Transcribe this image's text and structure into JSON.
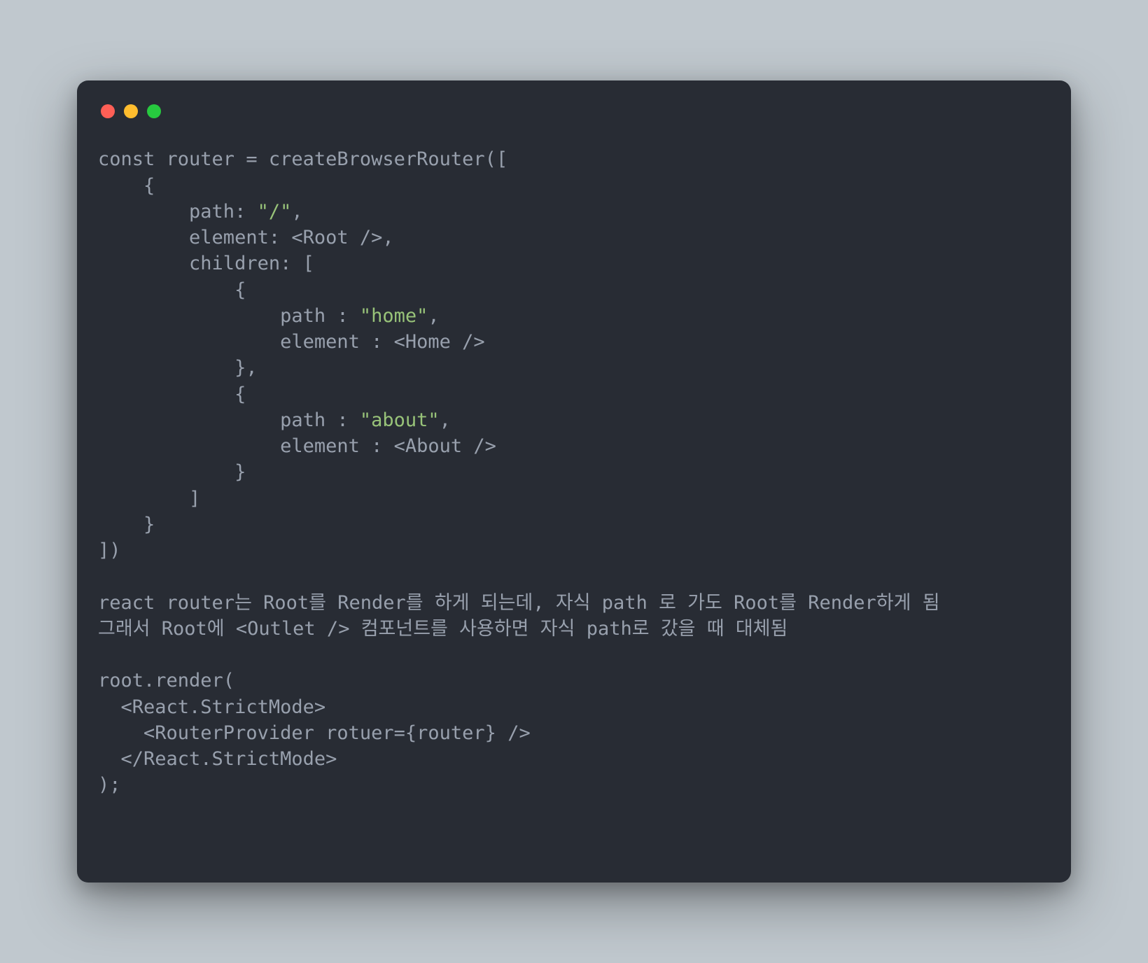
{
  "colors": {
    "background": "#c0c8ce",
    "window": "#282c34",
    "text": "#98a0ad",
    "string": "#98c379",
    "trafficRed": "#ff5f56",
    "trafficYellow": "#ffbd2e",
    "trafficGreen": "#27c93f"
  },
  "code": {
    "l1": "const router = createBrowserRouter([",
    "l2": "    {",
    "l3a": "        path: ",
    "l3s": "\"/\"",
    "l3b": ",",
    "l4": "        element: <Root />,",
    "l5": "        children: [",
    "l6": "            {",
    "l7a": "                path : ",
    "l7s": "\"home\"",
    "l7b": ",",
    "l8": "                element : <Home />",
    "l9": "            },",
    "l10": "            {",
    "l11a": "                path : ",
    "l11s": "\"about\"",
    "l11b": ",",
    "l12": "                element : <About />",
    "l13": "            }",
    "l14": "        ]",
    "l15": "    }",
    "l16": "])",
    "blank1": "",
    "c1": "react router는 Root를 Render를 하게 되는데, 자식 path 로 가도 Root를 Render하게 됨",
    "c2": "그래서 Root에 <Outlet /> 컴포넌트를 사용하면 자식 path로 갔을 때 대체됨",
    "blank2": "",
    "r1": "root.render(",
    "r2": "  <React.StrictMode>",
    "r3": "    <RouterProvider rotuer={router} />",
    "r4": "  </React.StrictMode>",
    "r5": ");"
  }
}
